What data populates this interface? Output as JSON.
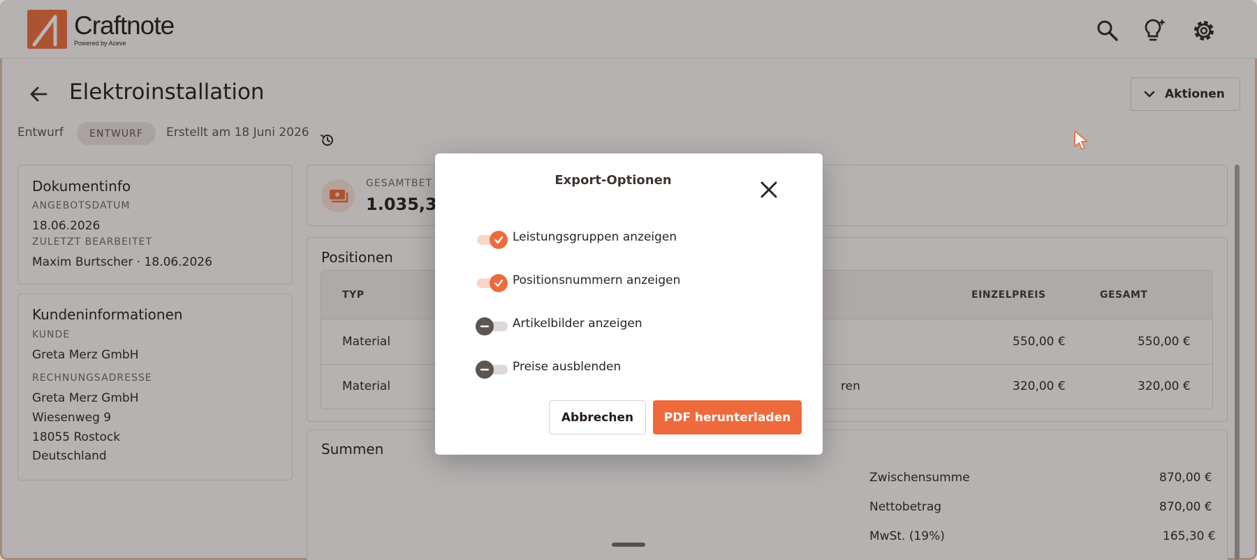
{
  "app": {
    "name": "Craftnote",
    "powered_by": "Powered by Aceve",
    "brand_color": "#ee6a3c"
  },
  "header": {
    "icons": [
      "search-icon",
      "lightbulb-sparkle-icon",
      "gear-icon"
    ]
  },
  "page": {
    "title": "Elektroinstallation",
    "status_text": "Entwurf",
    "status_badge": "ENTWURF",
    "created": "Erstellt am 18 Juni 2026",
    "actions_label": "Aktionen"
  },
  "document_info": {
    "title": "Dokumentinfo",
    "date_label": "ANGEBOTSDATUM",
    "date_value": "18.06.2026",
    "edited_label": "ZULETZT BEARBEITET",
    "edited_value": "Maxim Burtscher · 18.06.2026"
  },
  "customer_info": {
    "title": "Kundeninformationen",
    "customer_label": "KUNDE",
    "customer_value": "Greta Merz GmbH",
    "address_label": "RECHNUNGSADRESSE",
    "address_lines": [
      "Greta Merz GmbH",
      "Wiesenweg 9",
      "18055 Rostock",
      "Deutschland"
    ]
  },
  "total": {
    "label": "GESAMTBET",
    "value": "1.035,30"
  },
  "positions": {
    "title": "Positionen",
    "columns": [
      "TYP",
      "EINZELPREIS",
      "GESAMT"
    ],
    "rows": [
      {
        "type": "Material",
        "desc": "",
        "unit_price": "550,00 €",
        "total": "550,00 €"
      },
      {
        "type": "Material",
        "desc": "ren",
        "unit_price": "320,00 €",
        "total": "320,00 €"
      }
    ]
  },
  "sums": {
    "title": "Summen",
    "rows": [
      {
        "label": "Zwischensumme",
        "value": "870,00 €"
      },
      {
        "label": "Nettobetrag",
        "value": "870,00 €"
      },
      {
        "label": "MwSt. (19%)",
        "value": "165,30 €"
      }
    ]
  },
  "modal": {
    "title": "Export-Optionen",
    "options": [
      {
        "label": "Leistungsgruppen anzeigen",
        "checked": true
      },
      {
        "label": "Positionsnummern anzeigen",
        "checked": true
      },
      {
        "label": "Artikelbilder anzeigen",
        "checked": false
      },
      {
        "label": "Preise ausblenden",
        "checked": false
      }
    ],
    "cancel_label": "Abbrechen",
    "download_label": "PDF herunterladen"
  }
}
